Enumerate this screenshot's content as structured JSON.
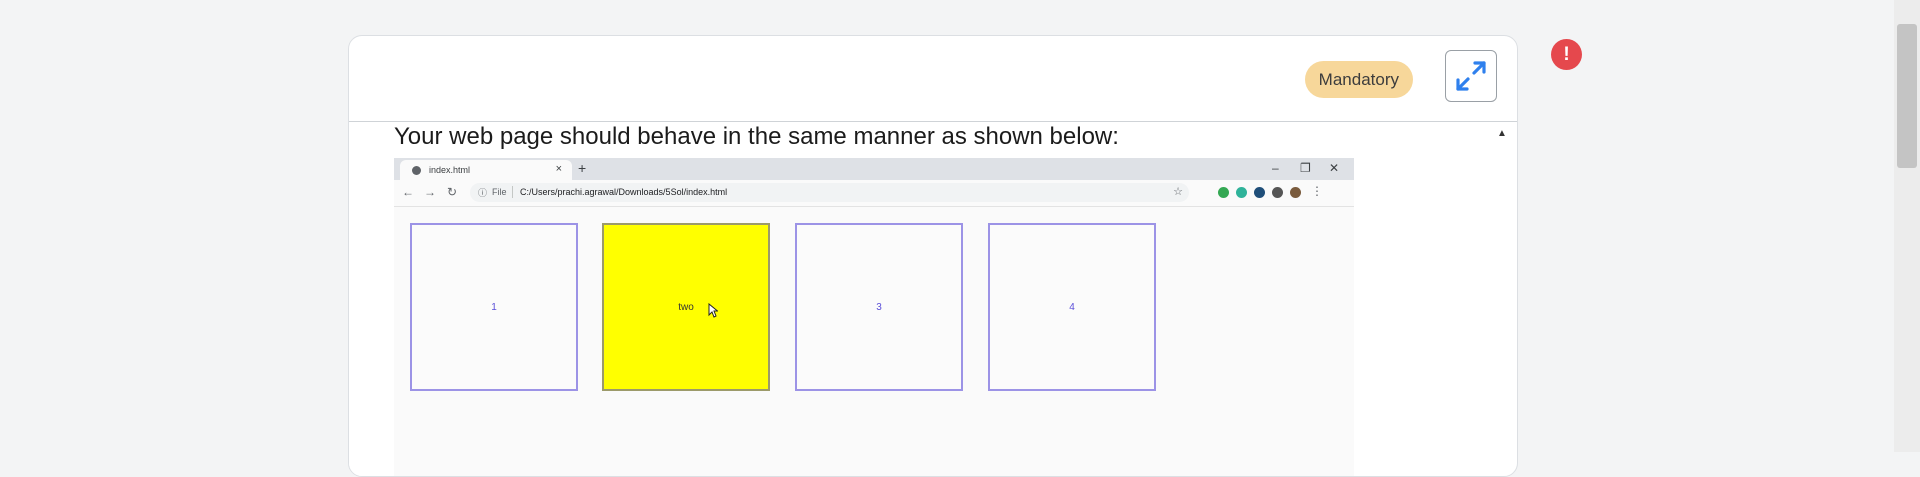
{
  "header": {
    "badge_label": "Mandatory",
    "expand_icon": "expand-arrows-icon"
  },
  "alert": {
    "icon": "exclamation-icon",
    "glyph": "!",
    "color": "#e5484d"
  },
  "content": {
    "instruction": "Your web page should behave in the same manner as shown below:"
  },
  "browser_screenshot": {
    "tab_title": "index.html",
    "tab_close": "×",
    "new_tab": "+",
    "window_controls": [
      "–",
      "❐",
      "✕"
    ],
    "address_file_label": "File",
    "url": "C:/Users/prachi.agrawal/Downloads/5Sol/index.html",
    "boxes": [
      {
        "label": "1",
        "highlighted": false
      },
      {
        "label": "two",
        "highlighted": true
      },
      {
        "label": "3",
        "highlighted": false
      },
      {
        "label": "4",
        "highlighted": false
      }
    ],
    "highlight_color": "#ffff00",
    "border_color": "#9c93e6"
  }
}
